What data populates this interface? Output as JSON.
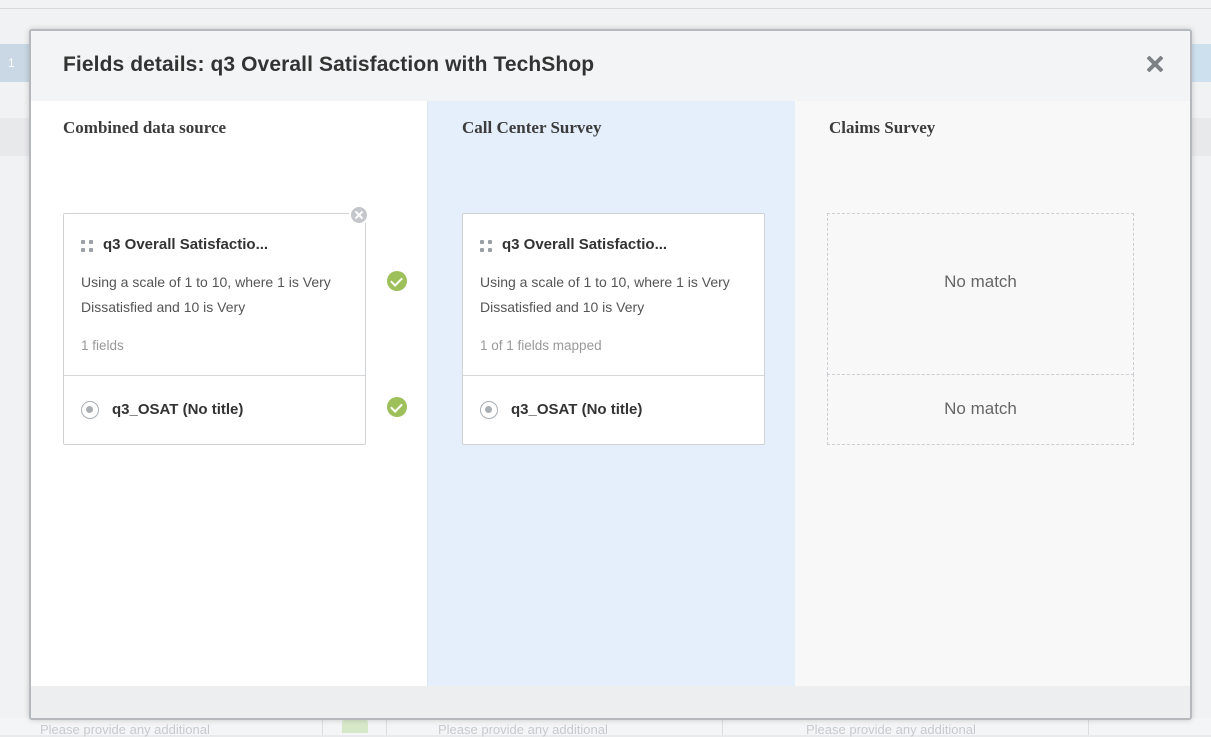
{
  "modal": {
    "title": "Fields details: q3 Overall Satisfaction with TechShop"
  },
  "background": {
    "tab_number": "1",
    "cells": [
      "Please provide any additional",
      "Please provide any additional",
      "Please provide any additional"
    ]
  },
  "columns": [
    {
      "title": "Combined data source",
      "card": {
        "title": "q3 Overall Satisfactio...",
        "description": "Using a scale of 1 to 10, where 1 is Very Dissatisfied and 10 is Very",
        "meta": "1 fields",
        "row_label": "q3_OSAT (No title)"
      }
    },
    {
      "title": "Call Center Survey",
      "card": {
        "title": "q3 Overall Satisfactio...",
        "description": "Using a scale of 1 to 10, where 1 is Very Dissatisfied and 10 is Very",
        "meta": "1 of 1 fields mapped",
        "row_label": "q3_OSAT (No title)"
      }
    },
    {
      "title": "Claims Survey",
      "no_match_header": "No match",
      "no_match_row": "No match"
    }
  ],
  "colors": {
    "accent_check": "#9ec05a",
    "selected_column_bg": "#e4effb"
  }
}
